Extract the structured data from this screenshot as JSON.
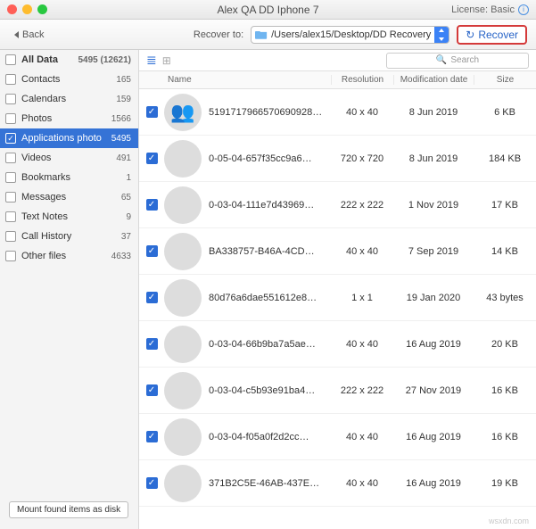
{
  "window": {
    "title": "Alex QA DD Iphone 7",
    "license_label": "License: Basic"
  },
  "toolbar": {
    "back_label": "Back",
    "recover_to_label": "Recover to:",
    "recover_path": "/Users/alex15/Desktop/DD Recovery",
    "recover_button_label": "Recover"
  },
  "sidebar": {
    "header_label": "All Data",
    "header_count": "5495 (12621)",
    "items": [
      {
        "label": "Contacts",
        "count": "165"
      },
      {
        "label": "Calendars",
        "count": "159"
      },
      {
        "label": "Photos",
        "count": "1566"
      },
      {
        "label": "Applications photo",
        "count": "5495"
      },
      {
        "label": "Videos",
        "count": "491"
      },
      {
        "label": "Bookmarks",
        "count": "1"
      },
      {
        "label": "Messages",
        "count": "65"
      },
      {
        "label": "Text Notes",
        "count": "9"
      },
      {
        "label": "Call History",
        "count": "37"
      },
      {
        "label": "Other files",
        "count": "4633"
      }
    ],
    "mount_button_label": "Mount found items as disk"
  },
  "columns": {
    "name": "Name",
    "resolution": "Resolution",
    "date": "Modification date",
    "size": "Size"
  },
  "search_placeholder": "Search",
  "rows": [
    {
      "name": "5191717966570690928…",
      "resolution": "40 x 40",
      "date": "8 Jun 2019",
      "size": "6 KB"
    },
    {
      "name": "0-05-04-657f35cc9a6…",
      "resolution": "720 x 720",
      "date": "8 Jun 2019",
      "size": "184 KB"
    },
    {
      "name": "0-03-04-111e7d43969…",
      "resolution": "222 x 222",
      "date": "1 Nov 2019",
      "size": "17 KB"
    },
    {
      "name": "BA338757-B46A-4CD…",
      "resolution": "40 x 40",
      "date": "7 Sep 2019",
      "size": "14 KB"
    },
    {
      "name": "80d76a6dae551612e8…",
      "resolution": "1 x 1",
      "date": "19 Jan 2020",
      "size": "43 bytes"
    },
    {
      "name": "0-03-04-66b9ba7a5ae…",
      "resolution": "40 x 40",
      "date": "16 Aug 2019",
      "size": "20 KB"
    },
    {
      "name": "0-03-04-c5b93e91ba4…",
      "resolution": "222 x 222",
      "date": "27 Nov 2019",
      "size": "16 KB"
    },
    {
      "name": "0-03-04-f05a0f2d2cc…",
      "resolution": "40 x 40",
      "date": "16 Aug 2019",
      "size": "16 KB"
    },
    {
      "name": "371B2C5E-46AB-437E…",
      "resolution": "40 x 40",
      "date": "16 Aug 2019",
      "size": "19 KB"
    }
  ],
  "watermark": "wsxdn.com"
}
